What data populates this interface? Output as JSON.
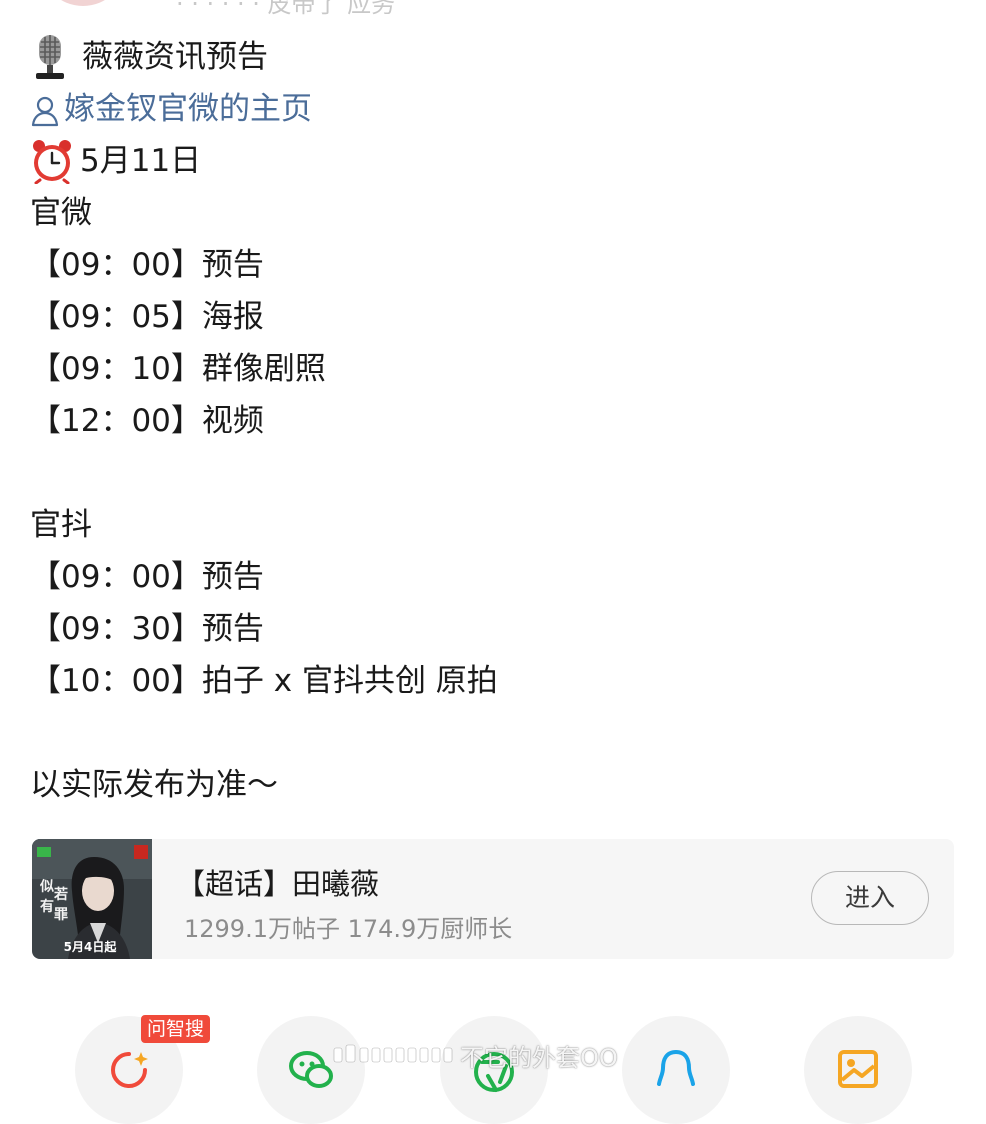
{
  "header": {
    "meta_partial": "· · · · · · 皮带了 应务"
  },
  "post": {
    "lines": [
      "薇薇资讯预告",
      "嫁金钗官微的主页",
      "5月11日",
      "官微",
      "【09：00】预告",
      "【09：05】海报",
      "【09：10】群像剧照",
      "【12：00】视频",
      "",
      "官抖",
      "【09：00】预告",
      "【09：30】预告",
      "【10：00】拍子 x 官抖共创 原拍",
      "",
      "以实际发布为准～"
    ]
  },
  "topic_card": {
    "title": "【超话】田曦薇",
    "stats": "1299.1万帖子 174.9万厨师长",
    "enter_label": "进入",
    "thumb_badge": "5月4日起"
  },
  "share_bar": {
    "ai_badge": "问智搜",
    "items": [
      "ai-search",
      "wechat",
      "moments",
      "qq",
      "save-image"
    ]
  },
  "watermark": {
    "text": "不它的外套OO"
  },
  "colors": {
    "link": "#4b6d99",
    "badge": "#f04a3a",
    "card_bg": "#f6f6f6"
  }
}
